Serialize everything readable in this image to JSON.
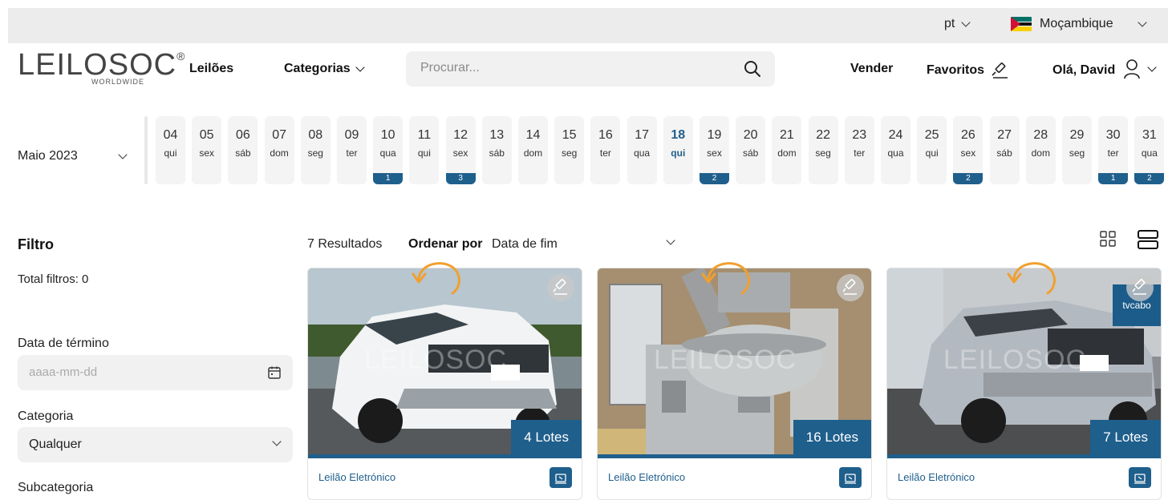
{
  "topbar": {
    "language": "pt",
    "country": "Moçambique"
  },
  "header": {
    "logo": "LEILOSOC",
    "logo_reg": "®",
    "logo_sub": "WORLDWIDE",
    "nav_auctions": "Leilões",
    "nav_categories": "Categorias",
    "search_placeholder": "Procurar...",
    "sell": "Vender",
    "favorites": "Favoritos",
    "greeting": "Olá, David"
  },
  "calendar": {
    "month": "Maio 2023",
    "days": [
      {
        "n": "04",
        "w": "qui"
      },
      {
        "n": "05",
        "w": "sex"
      },
      {
        "n": "06",
        "w": "sáb"
      },
      {
        "n": "07",
        "w": "dom"
      },
      {
        "n": "08",
        "w": "seg"
      },
      {
        "n": "09",
        "w": "ter"
      },
      {
        "n": "10",
        "w": "qua",
        "badge": "1"
      },
      {
        "n": "11",
        "w": "qui"
      },
      {
        "n": "12",
        "w": "sex",
        "badge": "3"
      },
      {
        "n": "13",
        "w": "sáb"
      },
      {
        "n": "14",
        "w": "dom"
      },
      {
        "n": "15",
        "w": "seg"
      },
      {
        "n": "16",
        "w": "ter"
      },
      {
        "n": "17",
        "w": "qua"
      },
      {
        "n": "18",
        "w": "qui",
        "selected": true
      },
      {
        "n": "19",
        "w": "sex",
        "badge": "2"
      },
      {
        "n": "20",
        "w": "sáb"
      },
      {
        "n": "21",
        "w": "dom"
      },
      {
        "n": "22",
        "w": "seg"
      },
      {
        "n": "23",
        "w": "ter"
      },
      {
        "n": "24",
        "w": "qua"
      },
      {
        "n": "25",
        "w": "qui"
      },
      {
        "n": "26",
        "w": "sex",
        "badge": "2"
      },
      {
        "n": "27",
        "w": "sáb"
      },
      {
        "n": "28",
        "w": "dom"
      },
      {
        "n": "29",
        "w": "seg"
      },
      {
        "n": "30",
        "w": "ter",
        "badge": "1"
      },
      {
        "n": "31",
        "w": "qua",
        "badge": "2"
      }
    ]
  },
  "filter": {
    "title": "Filtro",
    "total": "Total filtros: 0",
    "end_date_label": "Data de término",
    "end_date_placeholder": "aaaa-mm-dd",
    "category_label": "Categoria",
    "category_value": "Qualquer",
    "subcategory_label": "Subcategoria"
  },
  "results": {
    "count": "7 Resultados",
    "order_label": "Ordenar por",
    "order_value": "Data de fim"
  },
  "cards": [
    {
      "lots": "4 Lotes",
      "type": "Leilão Eletrónico",
      "watermark": "LEILOSOC"
    },
    {
      "lots": "16 Lotes",
      "type": "Leilão Eletrónico",
      "watermark": "LEILOSOC"
    },
    {
      "lots": "7 Lotes",
      "type": "Leilão Eletrónico",
      "watermark": "LEILOSOC",
      "tv_logo": "tvcabo"
    }
  ],
  "colors": {
    "brand_blue": "#1f5f8c",
    "accent_orange": "#f0a030",
    "topbar_bg": "#ececec"
  }
}
